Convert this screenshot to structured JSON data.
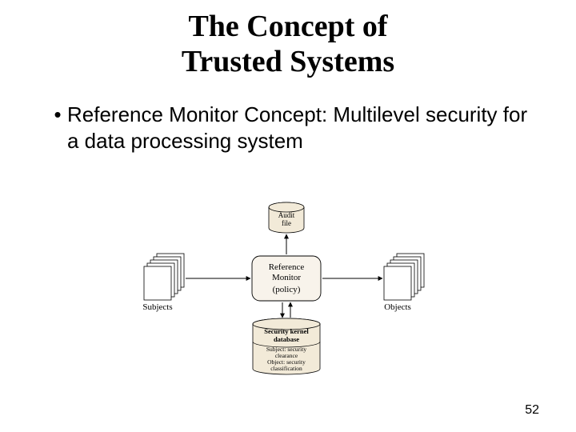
{
  "title_line1": "The Concept of",
  "title_line2": "Trusted Systems",
  "bullet_text": "Reference Monitor Concept: Multilevel security for a data processing system",
  "diagram": {
    "subjects_label": "Subjects",
    "objects_label": "Objects",
    "reference_monitor_line1": "Reference",
    "reference_monitor_line2": "Monitor",
    "reference_monitor_line3": "(policy)",
    "audit_file_line1": "Audit",
    "audit_file_line2": "file",
    "sec_db_line1": "Security kernel",
    "sec_db_line2": "database",
    "sec_db_sub_line1": "Subject: security",
    "sec_db_sub_line2": "clearance",
    "sec_db_sub_line3": "Object: security",
    "sec_db_sub_line4": "classification"
  },
  "page_number": "52"
}
